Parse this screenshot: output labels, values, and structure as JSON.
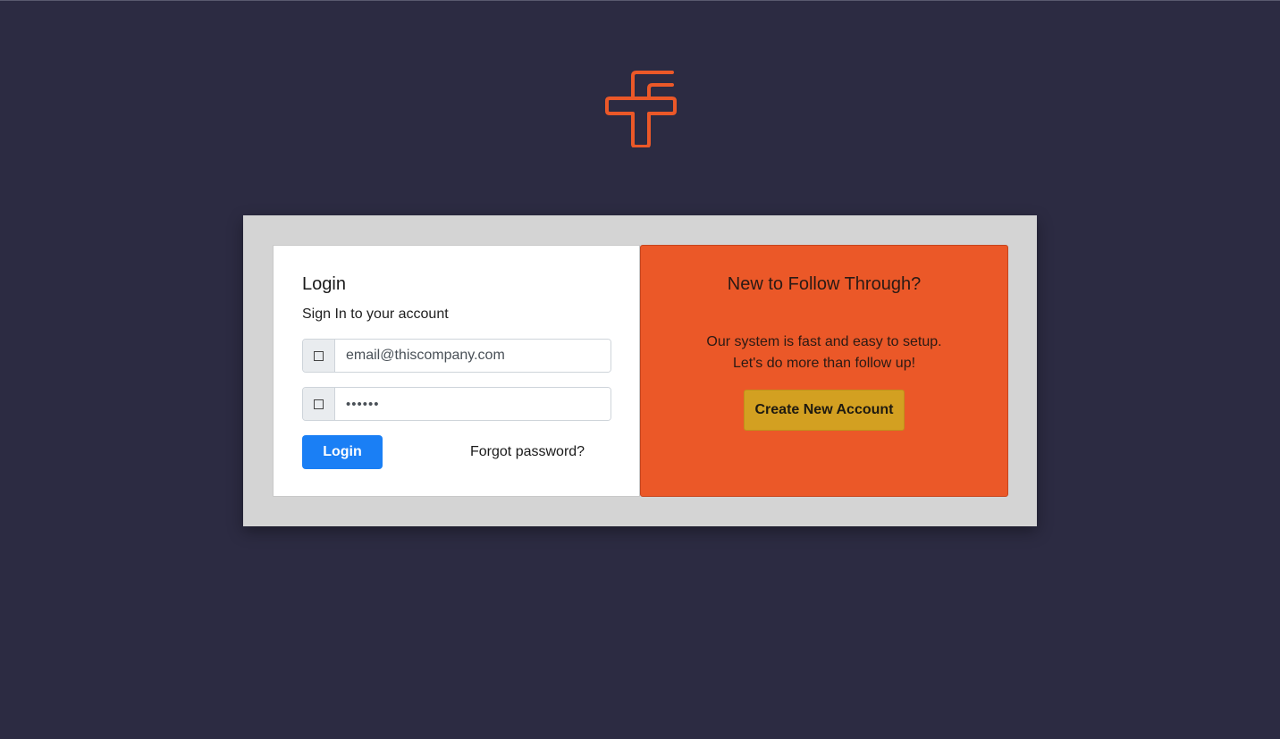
{
  "brand": {
    "logo_icon": "follow-through-logo-icon",
    "accent_color": "#eb5828",
    "background_color": "#2c2b42"
  },
  "login": {
    "title": "Login",
    "subtitle": "Sign In to your account",
    "email": {
      "icon": "user-icon",
      "value": "email@thiscompany.com"
    },
    "password": {
      "icon": "lock-icon",
      "value": "••••••"
    },
    "login_button": "Login",
    "forgot_link": "Forgot password?",
    "button_color": "#1a7ff5"
  },
  "signup": {
    "title": "New to Follow Through?",
    "line1": "Our system is fast and easy to setup.",
    "line2": "Let's do more than follow up!",
    "create_button": "Create New Account",
    "button_color": "#d3a021"
  }
}
